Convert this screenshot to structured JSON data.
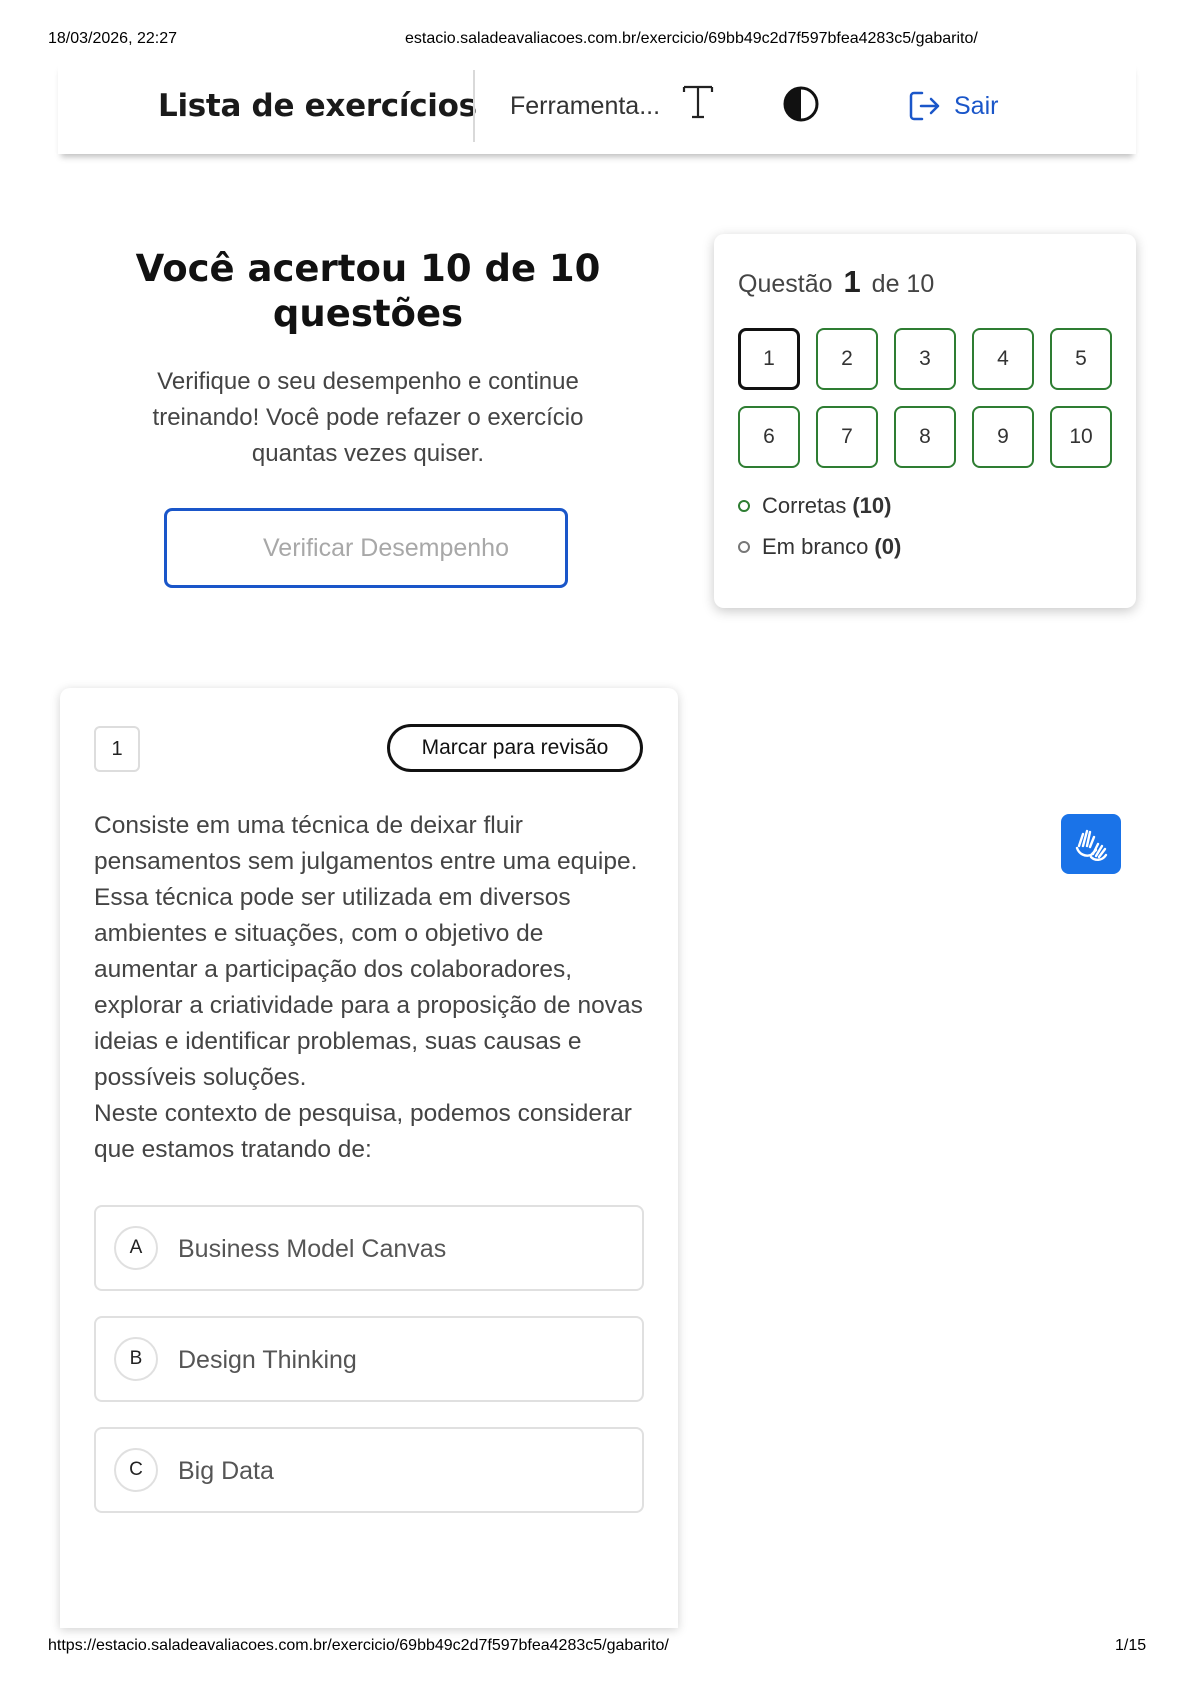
{
  "print": {
    "datetime": "18/03/2026, 22:27",
    "header_url": "estacio.saladeavaliacoes.com.br/exercicio/69bb49c2d7f597bfea4283c5/gabarito/",
    "footer_url": "https://estacio.saladeavaliacoes.com.br/exercicio/69bb49c2d7f597bfea4283c5/gabarito/",
    "page": "1/15"
  },
  "header": {
    "title": "Lista de exercícios",
    "tools_label": "Ferramenta...",
    "font_icon": "font-size-icon",
    "contrast_icon": "contrast-icon",
    "logout_label": "Sair",
    "logout_icon": "logout-icon"
  },
  "result": {
    "title": "Você acertou 10 de 10 questões",
    "subtitle": "Verifique o seu desempenho e continue treinando! Você pode refazer o exercício quantas vezes quiser.",
    "verify_button": "Verificar Desempenho"
  },
  "navigator": {
    "prefix": "Questão",
    "current": "1",
    "suffix": "de 10",
    "questions": [
      "1",
      "2",
      "3",
      "4",
      "5",
      "6",
      "7",
      "8",
      "9",
      "10"
    ],
    "correct_label": "Corretas",
    "correct_count": "(10)",
    "blank_label": "Em branco",
    "blank_count": "(0)"
  },
  "question": {
    "number": "1",
    "mark_button": "Marcar para revisão",
    "paragraph1": "Consiste em uma técnica de deixar fluir pensamentos sem julgamentos entre uma equipe. Essa técnica pode ser utilizada em diversos ambientes e situações, com o objetivo de aumentar a participação dos colaboradores, explorar a criatividade para a proposição de novas ideias e identificar problemas, suas causas e possíveis soluções.",
    "paragraph2": "Neste contexto de pesquisa, podemos considerar que estamos tratando de:",
    "options": [
      {
        "letter": "A",
        "text": "Business Model Canvas"
      },
      {
        "letter": "B",
        "text": "Design Thinking"
      },
      {
        "letter": "C",
        "text": "Big Data"
      }
    ]
  },
  "accessibility": {
    "libras_icon": "sign-language-hands-icon"
  },
  "colors": {
    "primary": "#1a56c9",
    "correct": "#2e7d32",
    "libras_bg": "#1a73e8"
  }
}
